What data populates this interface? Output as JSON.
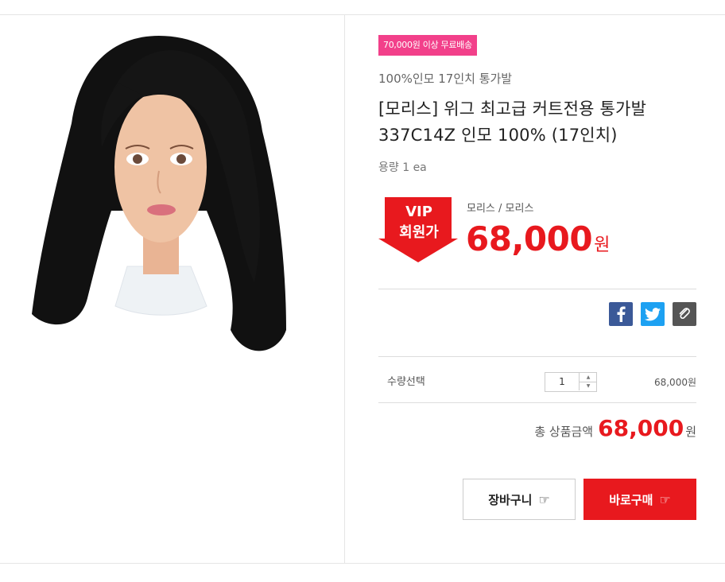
{
  "product": {
    "image_alt": "wig on mannequin head",
    "badge": "70,000원 이상 무료배송",
    "subtitle": "100%인모 17인치 통가발",
    "title": "[모리스] 위그 최고급 커트전용 통가발 337C14Z 인모 100% (17인치)",
    "volume": "용량 1 ea"
  },
  "pricing": {
    "vip_line1": "VIP",
    "vip_line2": "회원가",
    "brand": "모리스 / 모리스",
    "price": "68,000",
    "unit": "원"
  },
  "share": {
    "facebook_icon": "f",
    "twitter_icon": "twitter-bird",
    "link_icon": "paperclip"
  },
  "quantity": {
    "label": "수량선택",
    "value": "1",
    "line_price": "68,000원"
  },
  "total": {
    "label": "총 상품금액",
    "value": "68,000",
    "unit": "원"
  },
  "buttons": {
    "cart": "장바구니",
    "buy": "바로구매",
    "hand_icon": "☞"
  },
  "colors": {
    "accent": "#e8191e",
    "badge": "#f2408a"
  }
}
